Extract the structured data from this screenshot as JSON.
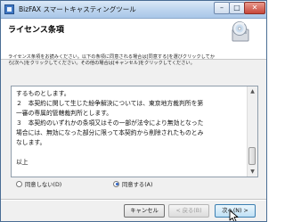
{
  "window": {
    "title": "BizFAX スマートキャスティングツール",
    "minimize_glyph": "–",
    "maximize_glyph": "□",
    "close_glyph": "✕"
  },
  "header": {
    "heading": "ライセンス条項",
    "icon": "installer-disc-icon",
    "instructions": [
      "ライセンス条項をお読みください。以下の条項に同意される場合は[同意する]を選びクリックしてか",
      "ら[次へ]をクリックしてください。その他の場合は[キャンセル]をクリックしてください。"
    ]
  },
  "license": {
    "lines": [
      "するものとします。",
      "２　本契約に関して生じた紛争解決については、東京地方裁判所を第",
      "一審の専属的管轄裁判所とします。",
      "３　本契約のいずれかの条項又はその一部が法令により無効となった",
      "場合には、無効になった部分に限って本契約から削除されたものとみ",
      "なします。",
      "",
      "以上"
    ]
  },
  "options": {
    "decline_label": "同意しない(D)",
    "accept_label": "同意する(A)",
    "selected": "accept"
  },
  "buttons": {
    "cancel": "キャンセル",
    "back": "< 戻る(B)",
    "next": "次へ(N) >"
  },
  "colors": {
    "titlebar": "#bcd4ee",
    "accent": "#2d64c8"
  }
}
